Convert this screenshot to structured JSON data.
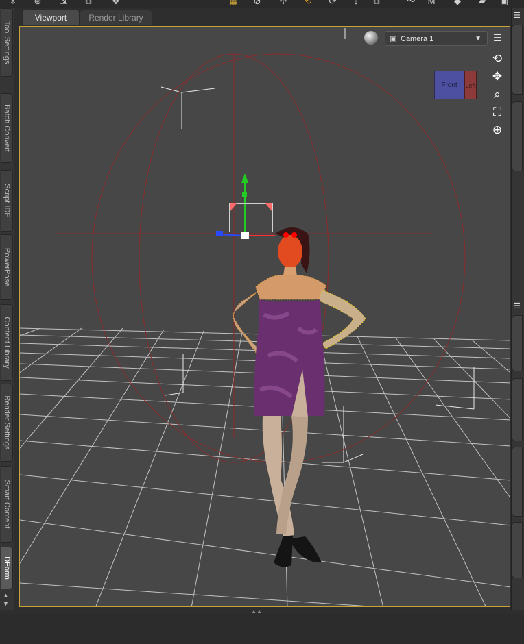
{
  "tabs": [
    {
      "label": "Viewport",
      "active": true
    },
    {
      "label": "Render Library",
      "active": false
    }
  ],
  "left_dock_tabs": [
    {
      "label": "Tool Settings"
    },
    {
      "label": "Batch Convert"
    },
    {
      "label": "Script IDE"
    },
    {
      "label": "PowerPose"
    },
    {
      "label": "Content Library"
    },
    {
      "label": "Render Settings"
    },
    {
      "label": "Smart Content"
    },
    {
      "label": "DForm",
      "active": true
    }
  ],
  "viewport": {
    "camera": "Camera 1",
    "camera_icon": "camera-icon",
    "view_cube": {
      "front_label": "Front",
      "right_label": "Left"
    },
    "nav_icons": [
      "orbit-icon",
      "pan-icon",
      "zoom-icon",
      "frame-icon",
      "reset-icon"
    ]
  },
  "colors": {
    "accent_border": "#c8a23a",
    "viewport_bg": "#474747",
    "grid": "#d0d0d0",
    "sphere": "#8a2a2a",
    "dress": "#6a2f6e",
    "skin": "#c9b09a"
  },
  "toolbar_icons": [
    "move-icon",
    "rotate-icon",
    "camera-icon",
    "scale-icon",
    "add-icon",
    "figure-icon",
    "morph-icon",
    "anchor-icon"
  ]
}
